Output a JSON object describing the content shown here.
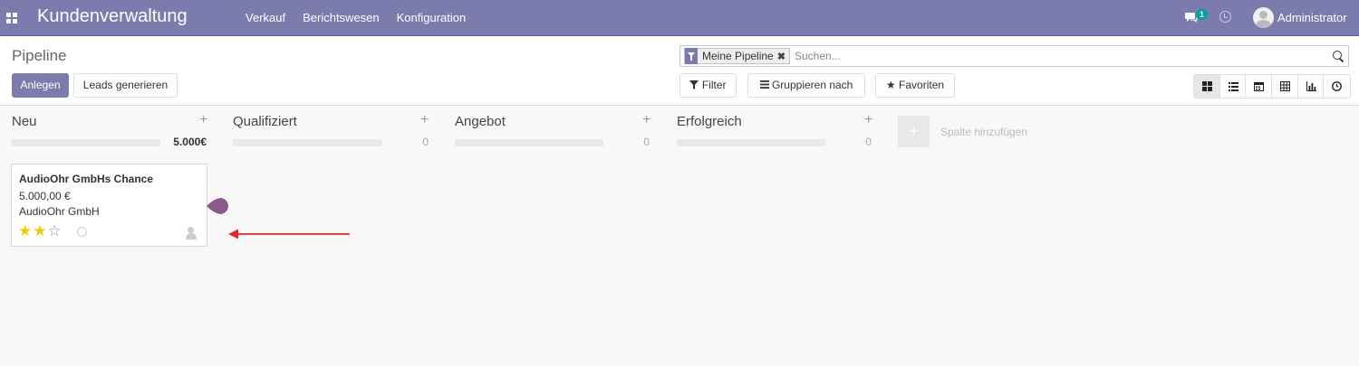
{
  "navbar": {
    "brand": "Kundenverwaltung",
    "menu": [
      "Verkauf",
      "Berichtswesen",
      "Konfiguration"
    ],
    "chat_count": "1",
    "user": "Administrator"
  },
  "control": {
    "title": "Pipeline",
    "create_label": "Anlegen",
    "generate_label": "Leads generieren",
    "facet_label": "Meine Pipeline",
    "search_placeholder": "Suchen...",
    "filter_label": "Filter",
    "group_label": "Gruppieren nach",
    "favorites_label": "Favoriten",
    "views": [
      "kanban-icon",
      "list-icon",
      "calendar-icon",
      "pivot-icon",
      "graph-icon",
      "activity-icon"
    ]
  },
  "kanban": {
    "columns": [
      {
        "title": "Neu",
        "sum": "5.000€"
      },
      {
        "title": "Qualifiziert",
        "sum": "0"
      },
      {
        "title": "Angebot",
        "sum": "0"
      },
      {
        "title": "Erfolgreich",
        "sum": "0"
      }
    ],
    "add_column_label": "Spalte hinzufügen",
    "card": {
      "title": "AudioOhr GmbHs Chance",
      "amount": "5.000,00 €",
      "partner": "AudioOhr GmbH",
      "stars_on": "★★",
      "stars_off": "☆",
      "rating": 2
    }
  },
  "colors": {
    "brand": "#7c7bad",
    "star": "#f3cc00",
    "annotation_arrow": "#e8271e",
    "drop_marker": "#8b5a8c"
  }
}
